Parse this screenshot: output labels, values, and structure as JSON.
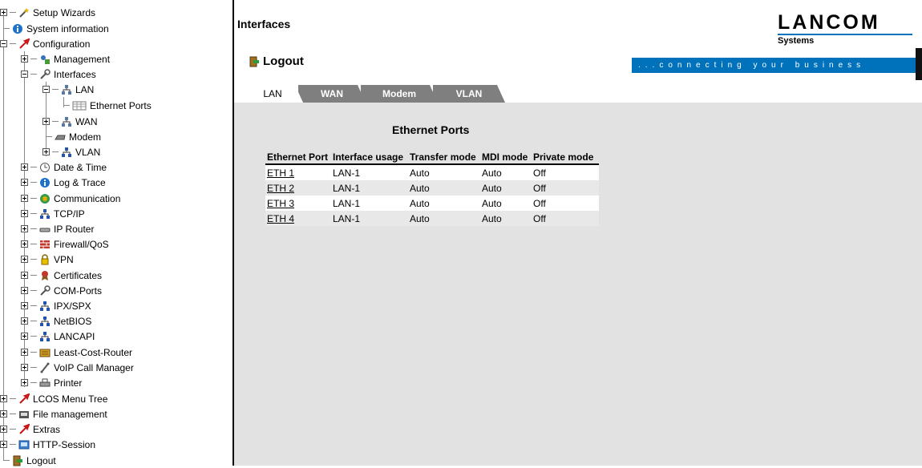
{
  "tree": {
    "items": [
      {
        "label": "Setup Wizards",
        "icon": "wand-icon"
      },
      {
        "label": "System information",
        "icon": "info-icon"
      },
      {
        "label": "Configuration",
        "icon": "red-arrow-icon"
      },
      {
        "label": "Management",
        "icon": "management-icon"
      },
      {
        "label": "Interfaces",
        "icon": "tools-icon"
      },
      {
        "label": "LAN",
        "icon": "lan-icon"
      },
      {
        "label": "Ethernet Ports",
        "icon": "table-icon"
      },
      {
        "label": "WAN",
        "icon": "lan-icon"
      },
      {
        "label": "Modem",
        "icon": "modem-icon"
      },
      {
        "label": "VLAN",
        "icon": "network-icon"
      },
      {
        "label": "Date & Time",
        "icon": "clock-icon"
      },
      {
        "label": "Log & Trace",
        "icon": "info-icon"
      },
      {
        "label": "Communication",
        "icon": "communication-icon"
      },
      {
        "label": "TCP/IP",
        "icon": "network-icon"
      },
      {
        "label": "IP Router",
        "icon": "router-icon"
      },
      {
        "label": "Firewall/QoS",
        "icon": "firewall-icon"
      },
      {
        "label": "VPN",
        "icon": "lock-icon"
      },
      {
        "label": "Certificates",
        "icon": "certificate-icon"
      },
      {
        "label": "COM-Ports",
        "icon": "tools-icon"
      },
      {
        "label": "IPX/SPX",
        "icon": "network-icon"
      },
      {
        "label": "NetBIOS",
        "icon": "network-icon"
      },
      {
        "label": "LANCAPI",
        "icon": "network-icon"
      },
      {
        "label": "Least-Cost-Router",
        "icon": "router-cost-icon"
      },
      {
        "label": "VoIP Call Manager",
        "icon": "phone-icon"
      },
      {
        "label": "Printer",
        "icon": "printer-icon"
      },
      {
        "label": "LCOS Menu Tree",
        "icon": "red-arrow-icon"
      },
      {
        "label": "File management",
        "icon": "file-management-icon"
      },
      {
        "label": "Extras",
        "icon": "red-arrow-icon"
      },
      {
        "label": "HTTP-Session",
        "icon": "session-icon"
      },
      {
        "label": "Logout",
        "icon": "logout-icon"
      }
    ]
  },
  "header": {
    "title": "Interfaces",
    "logout_label": "Logout",
    "logo_text": "LANCOM",
    "logo_sub": "Systems",
    "tagline": "...connecting your business",
    "brand_color": "#0072bc"
  },
  "tabs": [
    {
      "label": "LAN",
      "active": true
    },
    {
      "label": "WAN",
      "active": false
    },
    {
      "label": "Modem",
      "active": false
    },
    {
      "label": "VLAN",
      "active": false
    }
  ],
  "section": {
    "title": "Ethernet Ports",
    "columns": [
      "Ethernet Port",
      "Interface usage",
      "Transfer mode",
      "MDI mode",
      "Private mode"
    ],
    "rows": [
      {
        "port": "ETH 1",
        "usage": "LAN-1",
        "transfer": "Auto",
        "mdi": "Auto",
        "private": "Off"
      },
      {
        "port": "ETH 2",
        "usage": "LAN-1",
        "transfer": "Auto",
        "mdi": "Auto",
        "private": "Off"
      },
      {
        "port": "ETH 3",
        "usage": "LAN-1",
        "transfer": "Auto",
        "mdi": "Auto",
        "private": "Off"
      },
      {
        "port": "ETH 4",
        "usage": "LAN-1",
        "transfer": "Auto",
        "mdi": "Auto",
        "private": "Off"
      }
    ]
  }
}
